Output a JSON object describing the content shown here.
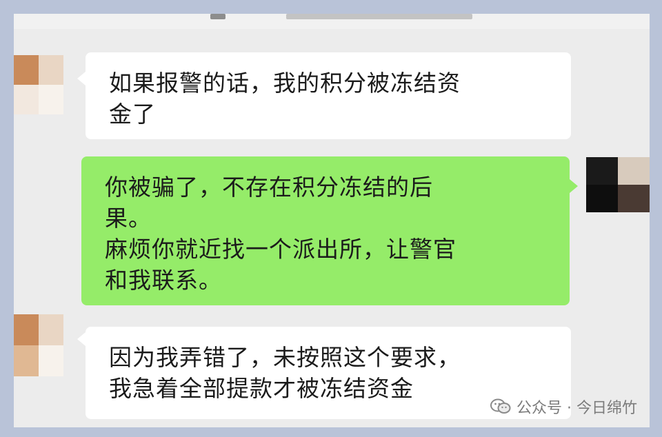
{
  "conversation": {
    "messages": [
      {
        "side": "incoming",
        "lines": [
          "如果报警的话，我的积分被冻结资",
          "金了"
        ]
      },
      {
        "side": "outgoing",
        "lines": [
          "你被骗了，不存在积分冻结的后",
          "果。",
          "麻烦你就近找一个派出所，让警官",
          "和我联系。"
        ]
      },
      {
        "side": "incoming",
        "lines": [
          "因为我弄错了，未按照这个要求，",
          "我急着全部提款才被冻结资金"
        ]
      }
    ]
  },
  "watermark": {
    "text": "公众号 · 今日绵竹",
    "icon": "wechat-official-account-icon"
  },
  "colors": {
    "background": "#ececec",
    "incoming_bubble": "#ffffff",
    "outgoing_bubble": "#95ec69",
    "text": "#1b1b1b",
    "outer_border": "#b9c3d8"
  }
}
